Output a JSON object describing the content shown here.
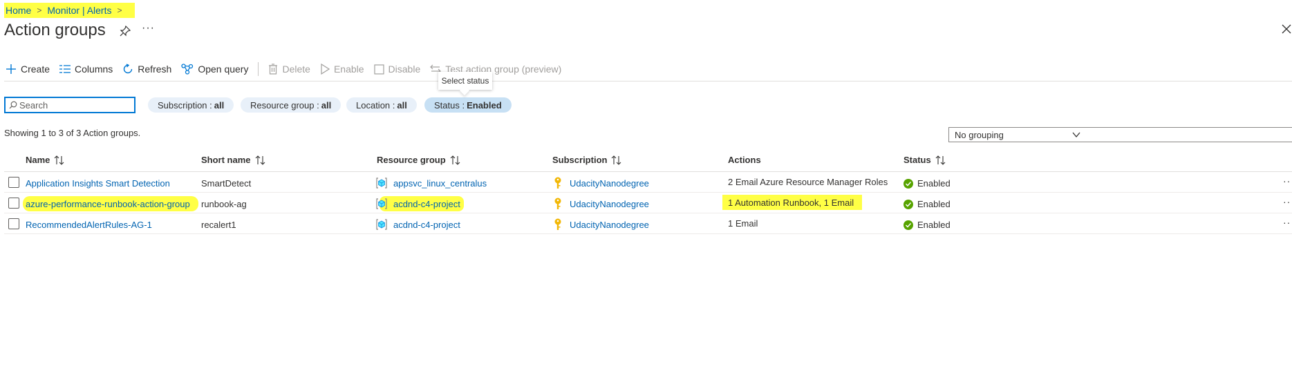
{
  "breadcrumb": {
    "items": [
      "Home",
      "Monitor | Alerts"
    ],
    "separator": ">"
  },
  "page": {
    "title": "Action groups",
    "more": "···"
  },
  "toolbar": {
    "create": "Create",
    "columns": "Columns",
    "refresh": "Refresh",
    "open_query": "Open query",
    "delete": "Delete",
    "enable": "Enable",
    "disable": "Disable",
    "test": "Test action group (preview)"
  },
  "tooltip": "Select status",
  "search": {
    "placeholder": "Search",
    "value": ""
  },
  "filters": [
    {
      "label": "Subscription :",
      "value": "all"
    },
    {
      "label": "Resource group :",
      "value": "all"
    },
    {
      "label": "Location :",
      "value": "all"
    },
    {
      "label": "Status :",
      "value": "Enabled"
    }
  ],
  "showing": "Showing 1 to 3 of 3 Action groups.",
  "grouping": {
    "selected": "No grouping"
  },
  "columns": [
    "Name",
    "Short name",
    "Resource group",
    "Subscription",
    "Actions",
    "Status"
  ],
  "rows": [
    {
      "name": "Application Insights Smart Detection",
      "short_name": "SmartDetect",
      "resource_group": "appsvc_linux_centralus",
      "subscription": "UdacityNanodegree",
      "actions": "2 Email Azure Resource Manager Roles",
      "status": "Enabled"
    },
    {
      "name": "azure-performance-runbook-action-group",
      "short_name": "runbook-ag",
      "resource_group": "acdnd-c4-project",
      "subscription": "UdacityNanodegree",
      "actions": "1 Automation Runbook, 1 Email",
      "status": "Enabled"
    },
    {
      "name": "RecommendedAlertRules-AG-1",
      "short_name": "recalert1",
      "resource_group": "acdnd-c4-project",
      "subscription": "UdacityNanodegree",
      "actions": "1 Email",
      "status": "Enabled"
    }
  ],
  "row_more": "···",
  "colors": {
    "accent": "#0078d4",
    "link": "#0063b1",
    "highlight": "#ffff45",
    "success": "#107c10"
  }
}
